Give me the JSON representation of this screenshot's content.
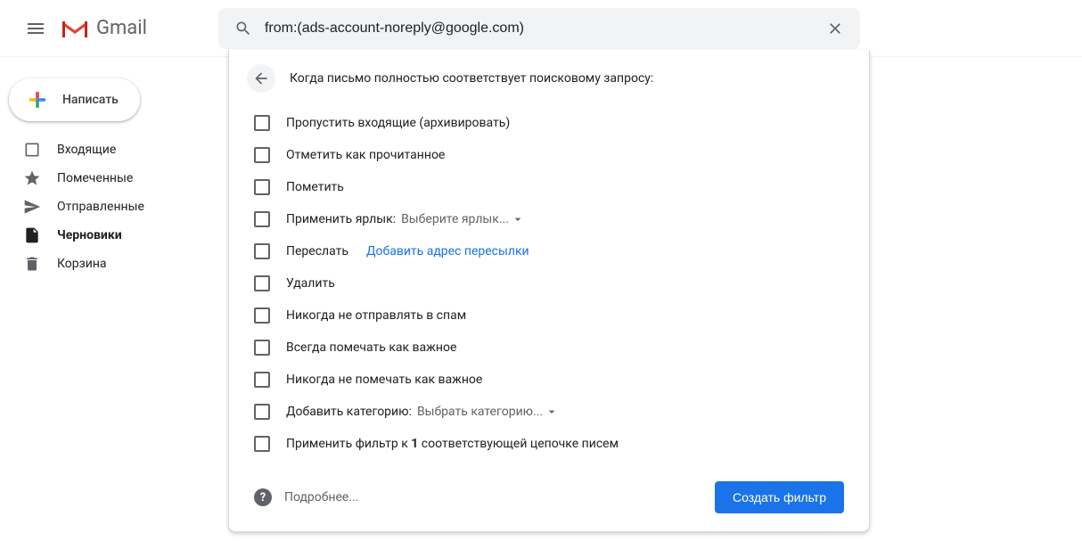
{
  "header": {
    "app_name": "Gmail",
    "search_value": "from:(ads-account-noreply@google.com)"
  },
  "sidebar": {
    "compose_label": "Написать",
    "items": [
      {
        "label": "Входящие",
        "icon": "inbox"
      },
      {
        "label": "Помеченные",
        "icon": "star"
      },
      {
        "label": "Отправленные",
        "icon": "send"
      },
      {
        "label": "Черновики",
        "icon": "draft",
        "active": true
      },
      {
        "label": "Корзина",
        "icon": "trash"
      }
    ]
  },
  "filter_panel": {
    "title": "Когда письмо полностью соответствует поисковому запросу:",
    "options": {
      "skip_inbox": "Пропустить входящие (архивировать)",
      "mark_read": "Отметить как прочитанное",
      "star_it": "Пометить",
      "apply_label_prefix": "Применить ярлык:",
      "apply_label_value": "Выберите ярлык...",
      "forward_prefix": "Переслать",
      "forward_link": "Добавить адрес пересылки",
      "delete": "Удалить",
      "never_spam": "Никогда не отправлять в спам",
      "always_important": "Всегда помечать как важное",
      "never_important": "Никогда не помечать как важное",
      "add_category_prefix": "Добавить категорию:",
      "add_category_value": "Выбрать категорию...",
      "apply_matching_before": "Применить фильтр к ",
      "apply_matching_count": "1",
      "apply_matching_after": " соответствующей цепочке писем"
    },
    "footer": {
      "learn_more": "Подробнее...",
      "create_button": "Создать фильтр"
    }
  }
}
